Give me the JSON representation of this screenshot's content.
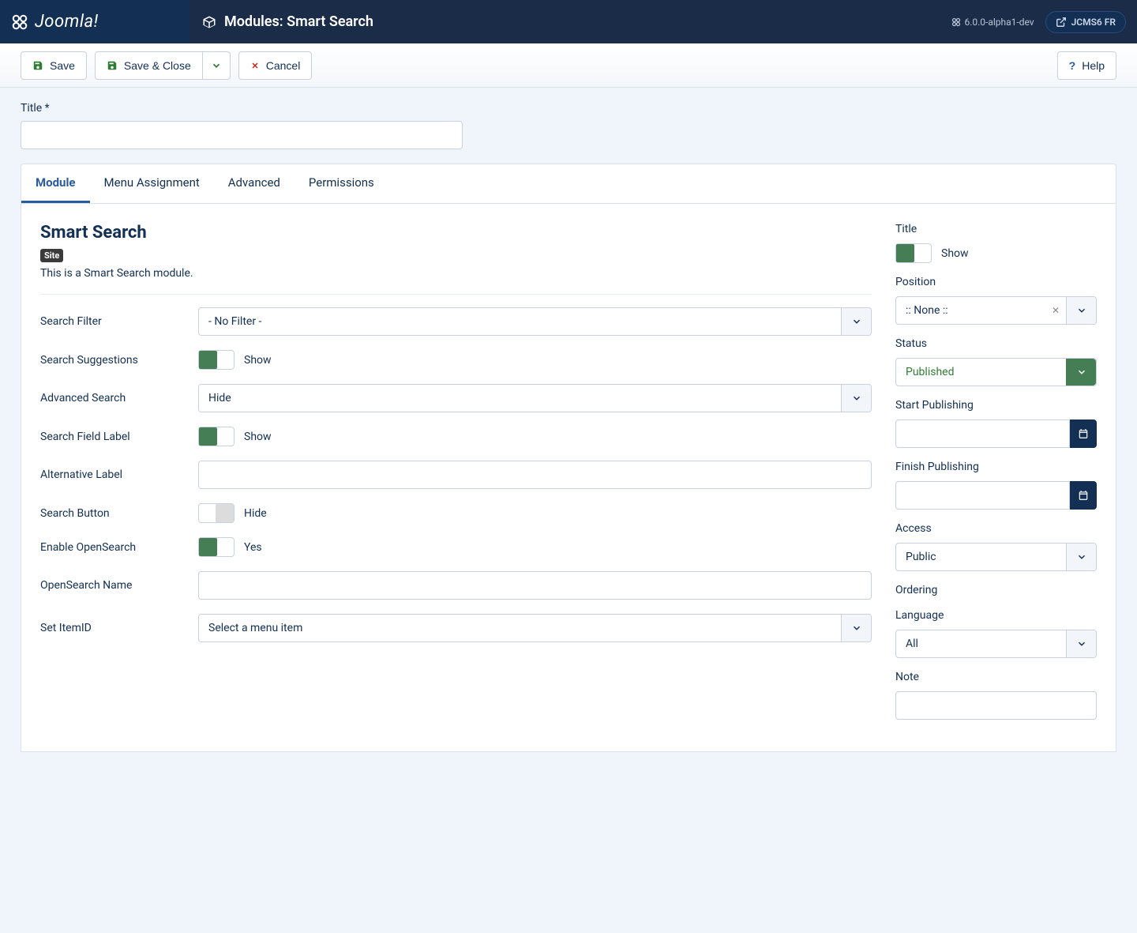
{
  "header": {
    "brand": "Joomla!",
    "pageTitle": "Modules: Smart Search",
    "version": "6.0.0-alpha1-dev",
    "siteName": "JCMS6 FR"
  },
  "toolbar": {
    "save": "Save",
    "saveClose": "Save & Close",
    "cancel": "Cancel",
    "help": "Help"
  },
  "titleField": {
    "label": "Title *",
    "value": ""
  },
  "tabs": [
    "Module",
    "Menu Assignment",
    "Advanced",
    "Permissions"
  ],
  "module": {
    "name": "Smart Search",
    "badge": "Site",
    "desc": "This is a Smart Search module."
  },
  "fields": {
    "searchFilter": {
      "label": "Search Filter",
      "value": "- No Filter -"
    },
    "suggestions": {
      "label": "Search Suggestions",
      "value": "Show"
    },
    "advanced": {
      "label": "Advanced Search",
      "value": "Hide"
    },
    "fieldLabel": {
      "label": "Search Field Label",
      "value": "Show"
    },
    "altLabel": {
      "label": "Alternative Label",
      "value": ""
    },
    "searchBtn": {
      "label": "Search Button",
      "value": "Hide"
    },
    "openSearch": {
      "label": "Enable OpenSearch",
      "value": "Yes"
    },
    "osName": {
      "label": "OpenSearch Name",
      "value": ""
    },
    "itemId": {
      "label": "Set ItemID",
      "value": "Select a menu item"
    }
  },
  "side": {
    "title": {
      "label": "Title",
      "value": "Show"
    },
    "position": {
      "label": "Position",
      "value": ":: None ::"
    },
    "status": {
      "label": "Status",
      "value": "Published"
    },
    "start": {
      "label": "Start Publishing",
      "value": ""
    },
    "finish": {
      "label": "Finish Publishing",
      "value": ""
    },
    "access": {
      "label": "Access",
      "value": "Public"
    },
    "ordering": {
      "label": "Ordering"
    },
    "language": {
      "label": "Language",
      "value": "All"
    },
    "note": {
      "label": "Note",
      "value": ""
    }
  }
}
